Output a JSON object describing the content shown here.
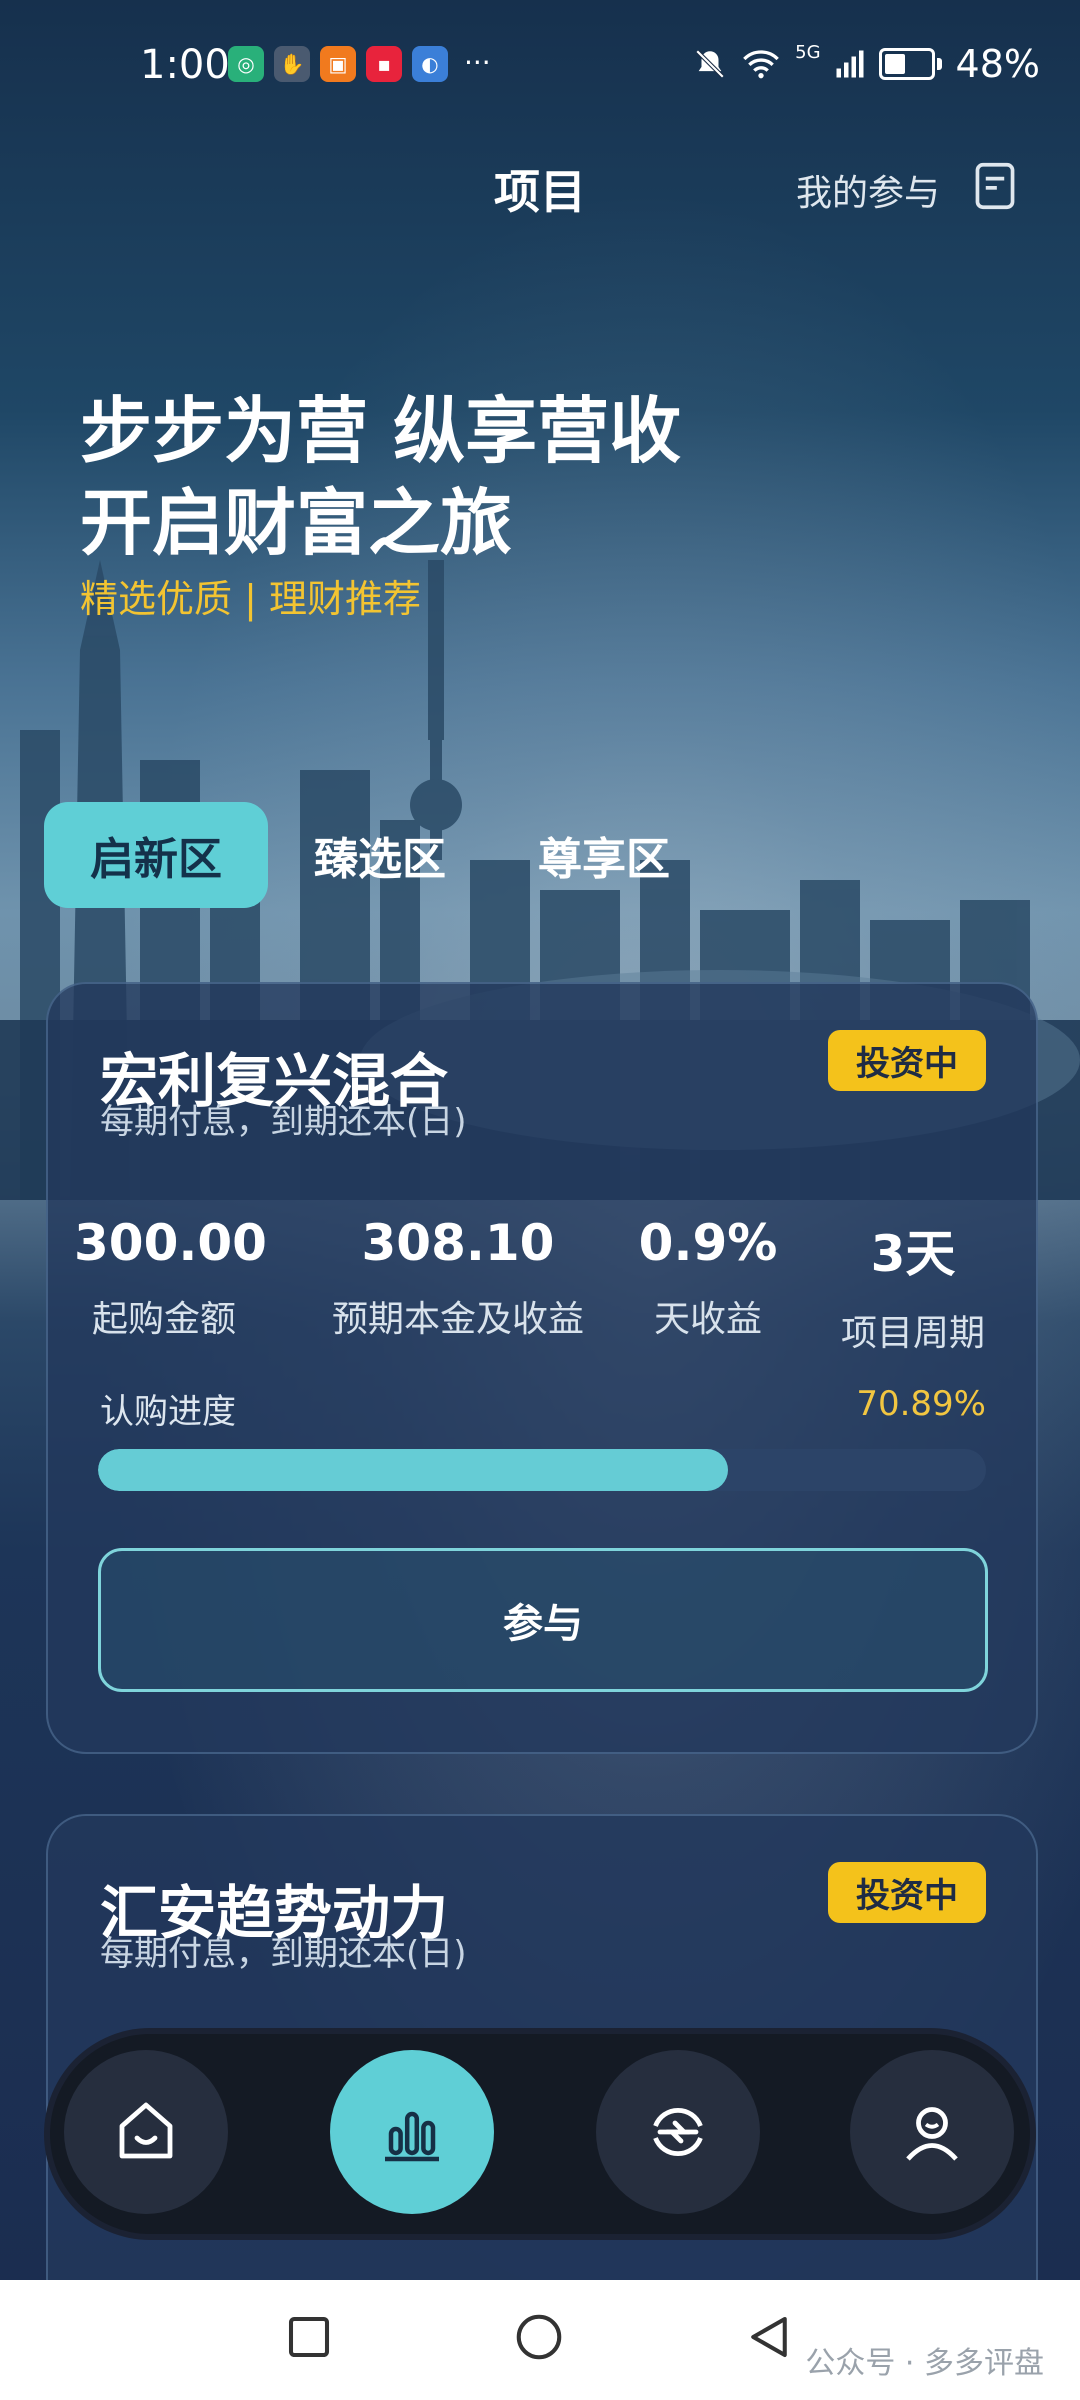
{
  "status_bar": {
    "time": "1:00",
    "more": "···",
    "signal": "5G",
    "battery": "48%"
  },
  "header": {
    "title": "项目",
    "my_participation": "我的参与"
  },
  "hero": {
    "line1": "步步为营 纵享营收",
    "line2": "开启财富之旅",
    "tagline": "精选优质 | 理财推荐"
  },
  "tabs": [
    {
      "label": "启新区",
      "active": true
    },
    {
      "label": "臻选区",
      "active": false
    },
    {
      "label": "尊享区",
      "active": false
    }
  ],
  "products": [
    {
      "name": "宏利复兴混合",
      "desc": "每期付息，到期还本(日)",
      "status": "投资中",
      "stats": [
        {
          "value": "300.00",
          "label": "起购金额"
        },
        {
          "value": "308.10",
          "label": "预期本金及收益"
        },
        {
          "value": "0.9%",
          "label": "天收益"
        },
        {
          "value": "3天",
          "label": "项目周期"
        }
      ],
      "progress_label": "认购进度",
      "progress_pct": "70.89%",
      "progress": 0.7089,
      "button": "参与"
    },
    {
      "name": "汇安趋势动力",
      "desc": "每期付息，到期还本(日)",
      "status": "投资中"
    }
  ],
  "nav": [
    {
      "icon": "home-icon",
      "active": false
    },
    {
      "icon": "chart-icon",
      "active": true
    },
    {
      "icon": "exchange-icon",
      "active": false
    },
    {
      "icon": "user-icon",
      "active": false
    }
  ],
  "watermark": "公众号 · 多多评盘",
  "colors": {
    "accent": "#5fcfd6",
    "badge": "#f4c21b",
    "tagline": "#f3c431"
  }
}
